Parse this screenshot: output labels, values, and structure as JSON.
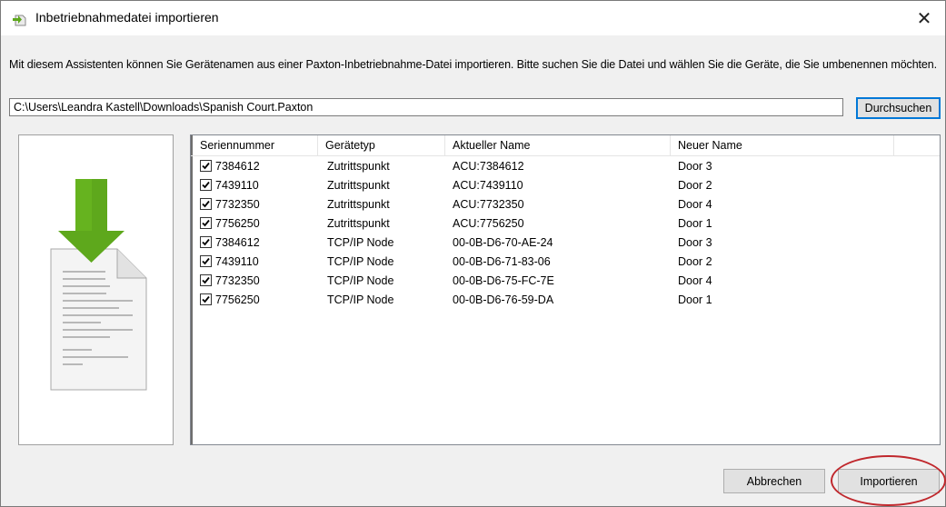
{
  "window": {
    "title": "Inbetriebnahmedatei importieren",
    "close_symbol": "✕"
  },
  "description": "Mit diesem Assistenten können Sie Gerätenamen aus einer Paxton-Inbetriebnahme-Datei importieren. Bitte suchen Sie die Datei und wählen Sie die Geräte, die Sie umbenennen möchten.",
  "file": {
    "path": "C:\\Users\\Leandra Kastell\\Downloads\\Spanish Court.Paxton",
    "browse_label": "Durchsuchen"
  },
  "table": {
    "columns": [
      "Seriennummer",
      "Gerätetyp",
      "Aktueller Name",
      "Neuer Name"
    ],
    "rows": [
      {
        "checked": true,
        "serial": "7384612",
        "type": "Zutrittspunkt",
        "current": "ACU:7384612",
        "new": "Door 3"
      },
      {
        "checked": true,
        "serial": "7439110",
        "type": "Zutrittspunkt",
        "current": "ACU:7439110",
        "new": "Door 2"
      },
      {
        "checked": true,
        "serial": "7732350",
        "type": "Zutrittspunkt",
        "current": "ACU:7732350",
        "new": "Door 4"
      },
      {
        "checked": true,
        "serial": "7756250",
        "type": "Zutrittspunkt",
        "current": "ACU:7756250",
        "new": "Door 1"
      },
      {
        "checked": true,
        "serial": "7384612",
        "type": "TCP/IP Node",
        "current": "00-0B-D6-70-AE-24",
        "new": "Door 3"
      },
      {
        "checked": true,
        "serial": "7439110",
        "type": "TCP/IP Node",
        "current": "00-0B-D6-71-83-06",
        "new": "Door 2"
      },
      {
        "checked": true,
        "serial": "7732350",
        "type": "TCP/IP Node",
        "current": "00-0B-D6-75-FC-7E",
        "new": "Door 4"
      },
      {
        "checked": true,
        "serial": "7756250",
        "type": "TCP/IP Node",
        "current": "00-0B-D6-76-59-DA",
        "new": "Door 1"
      }
    ]
  },
  "buttons": {
    "cancel": "Abbrechen",
    "import": "Importieren"
  },
  "icons": {
    "app": "import-file-icon",
    "illustration": "download-document-icon"
  },
  "colors": {
    "arrow_green": "#5ea81c",
    "highlight_circle": "#c0282d",
    "focus_border": "#0078d7"
  }
}
